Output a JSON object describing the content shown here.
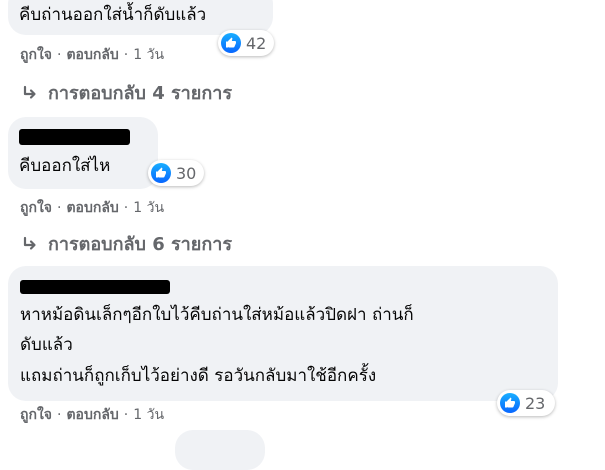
{
  "comments": [
    {
      "author": "",
      "lines": [
        "คีบถ่านออกใส่น้ำก็ดับแล้ว"
      ],
      "reaction_count": "42",
      "like_label": "ถูกใจ",
      "reply_label": "ตอบกลับ",
      "time": "1 วัน",
      "replies_link": "การตอบกลับ 4 รายการ"
    },
    {
      "author": "",
      "lines": [
        "คีบออกใส่ไห"
      ],
      "reaction_count": "30",
      "like_label": "ถูกใจ",
      "reply_label": "ตอบกลับ",
      "time": "1 วัน",
      "replies_link": "การตอบกลับ 6 รายการ"
    },
    {
      "author": "",
      "lines": [
        "หาหม้อดินเล็กๆอีกใบไว้คีบถ่านใส่หม้อแล้วปิดฝา ถ่านก็",
        "ดับแล้ว",
        "แถมถ่านก็ถูกเก็บไว้อย่างดี รอวันกลับมาใช้อีกครั้ง"
      ],
      "reaction_count": "23",
      "like_label": "ถูกใจ",
      "reply_label": "ตอบกลับ",
      "time": "1 วัน"
    }
  ],
  "separator": "·",
  "icons": {
    "reaction": "like-icon",
    "reply_arrow": "reply-arrow-icon"
  },
  "colors": {
    "like_blue": "#0866ff",
    "bubble": "#f0f2f5",
    "meta": "#65676b"
  }
}
